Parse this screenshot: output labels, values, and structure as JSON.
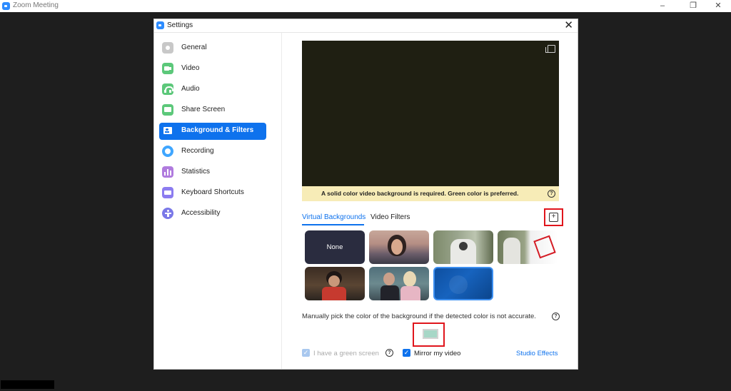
{
  "window": {
    "title": "Zoom Meeting"
  },
  "dialog": {
    "title": "Settings"
  },
  "sidebar": {
    "items": [
      {
        "label": "General",
        "icon": "gear-icon",
        "color": "#c8c8c8"
      },
      {
        "label": "Video",
        "icon": "video-camera-icon",
        "color": "#5cc87a"
      },
      {
        "label": "Audio",
        "icon": "headphones-icon",
        "color": "#5cc87a"
      },
      {
        "label": "Share Screen",
        "icon": "share-screen-icon",
        "color": "#5cc87a"
      },
      {
        "label": "Background & Filters",
        "icon": "person-background-icon",
        "color": "#ffffff",
        "active": true
      },
      {
        "label": "Recording",
        "icon": "record-icon",
        "color": "#3fa6ff"
      },
      {
        "label": "Statistics",
        "icon": "bar-chart-icon",
        "color": "#b07bde"
      },
      {
        "label": "Keyboard Shortcuts",
        "icon": "keyboard-icon",
        "color": "#8c7cf0"
      },
      {
        "label": "Accessibility",
        "icon": "accessibility-icon",
        "color": "#7a78e8"
      }
    ]
  },
  "notice": {
    "text": "A solid color video background is required. Green color is preferred."
  },
  "tabs": [
    {
      "label": "Virtual Backgrounds",
      "active": true
    },
    {
      "label": "Video Filters",
      "active": false
    }
  ],
  "backgrounds": {
    "none_label": "None"
  },
  "manual_pick": {
    "text": "Manually pick the color of the background if the detected color is not accurate."
  },
  "options": {
    "green_screen": "I have a green screen",
    "mirror": "Mirror my video",
    "studio_effects": "Studio Effects"
  },
  "colors": {
    "accent": "#0e72ed",
    "notice_bg": "#f7ecb7",
    "highlight": "#e0151c",
    "swatch": "#a7d7c7"
  }
}
